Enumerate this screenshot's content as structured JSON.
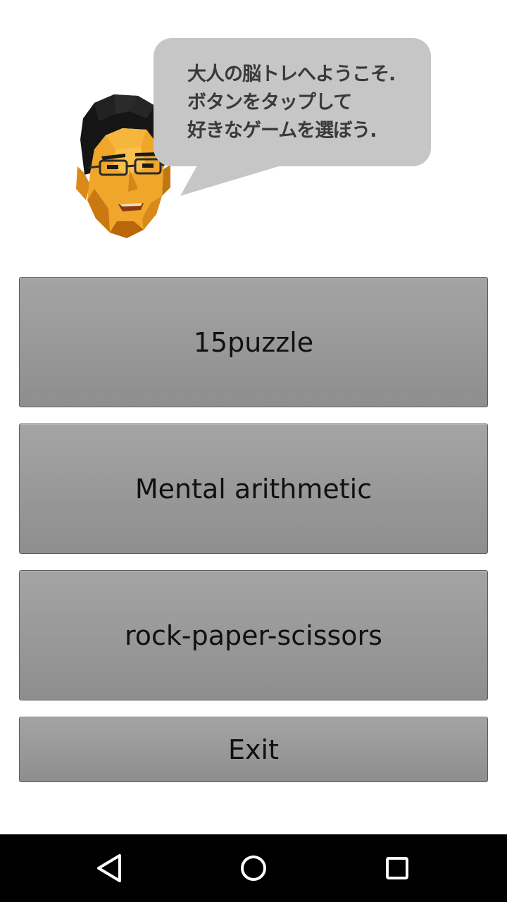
{
  "header": {
    "greeting_lines": [
      "大人の脳トレへようこそ.",
      "ボタンをタップして",
      "好きなゲームを選ぼう."
    ]
  },
  "menu": {
    "buttons": [
      {
        "label": "15puzzle"
      },
      {
        "label": "Mental arithmetic"
      },
      {
        "label": "rock-paper-scissors"
      },
      {
        "label": "Exit"
      }
    ]
  },
  "navbar": {
    "icons": [
      "back-icon",
      "home-icon",
      "recent-apps-icon"
    ]
  },
  "colors": {
    "button_fill": "#999999",
    "bubble_fill": "#c6c6c6",
    "navbar_bg": "#000000"
  }
}
